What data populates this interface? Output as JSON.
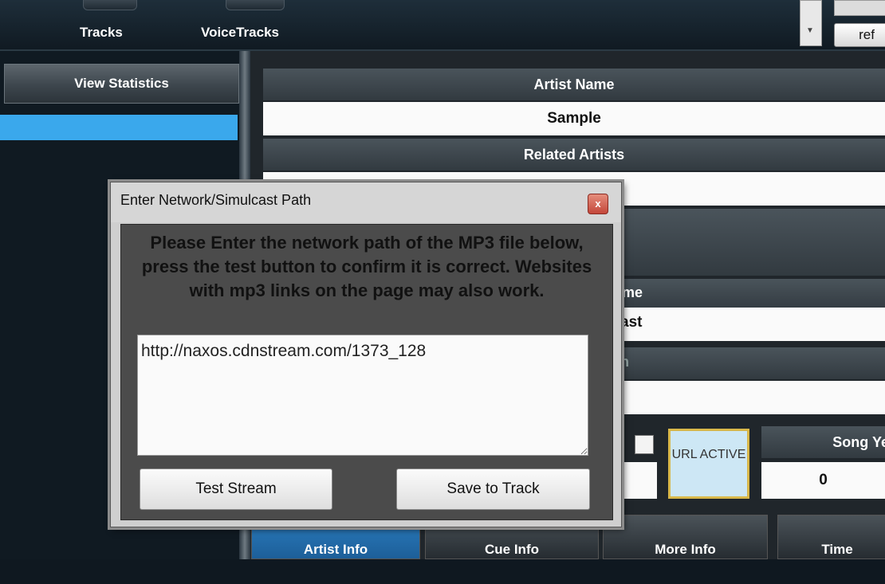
{
  "topbar": {
    "tabs": [
      "Tracks",
      "VoiceTracks"
    ],
    "refresh_label": "ref"
  },
  "left": {
    "view_statistics": "View Statistics"
  },
  "form": {
    "artist_name_label": "Artist Name",
    "artist_name_value": "Sample",
    "related_artists_label": "Related Artists",
    "partial_header_1": "me",
    "partial_value_1": "ast",
    "partial_header_2": "n",
    "url_active_label": "URL ACTIVE",
    "song_year_label": "Song Yea",
    "song_year_value": "0"
  },
  "bottom_tabs": [
    "Artist Info",
    "Cue Info",
    "More Info",
    "Time"
  ],
  "dialog": {
    "title": "Enter Network/Simulcast Path",
    "close_glyph": "x",
    "message": "Please Enter the network path of the MP3 file below, press the test button to confirm it is correct. Websites with mp3 links on the page may also work.",
    "path_value": "http://naxos.cdnstream.com/1373_128",
    "test_button": "Test Stream",
    "save_button": "Save to Track"
  },
  "colors": {
    "accent_blue": "#3aa8ec",
    "active_tab": "#2b7dc0",
    "url_highlight": "#d9b84a"
  }
}
